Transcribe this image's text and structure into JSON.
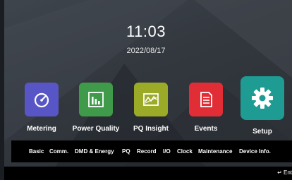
{
  "clock": {
    "time": "11:03",
    "date": "2022/08/17"
  },
  "tiles": [
    {
      "label": "Metering",
      "icon": "gauge-icon",
      "color": "#5856c7"
    },
    {
      "label": "Power Quality",
      "icon": "bar-chart-icon",
      "color": "#3f9a4a"
    },
    {
      "label": "PQ Insight",
      "icon": "waveform-icon",
      "color": "#9bab28"
    },
    {
      "label": "Events",
      "icon": "document-icon",
      "color": "#e12d35"
    },
    {
      "label": "Setup",
      "icon": "gear-icon",
      "color": "#1e9c94",
      "selected": true
    }
  ],
  "menu": [
    "Basic",
    "Comm.",
    "DMD & Energy",
    "PQ",
    "Record",
    "I/O",
    "Clock",
    "Maintenance",
    "Device Info."
  ],
  "footer": {
    "enter_label": "↵ Ent"
  }
}
